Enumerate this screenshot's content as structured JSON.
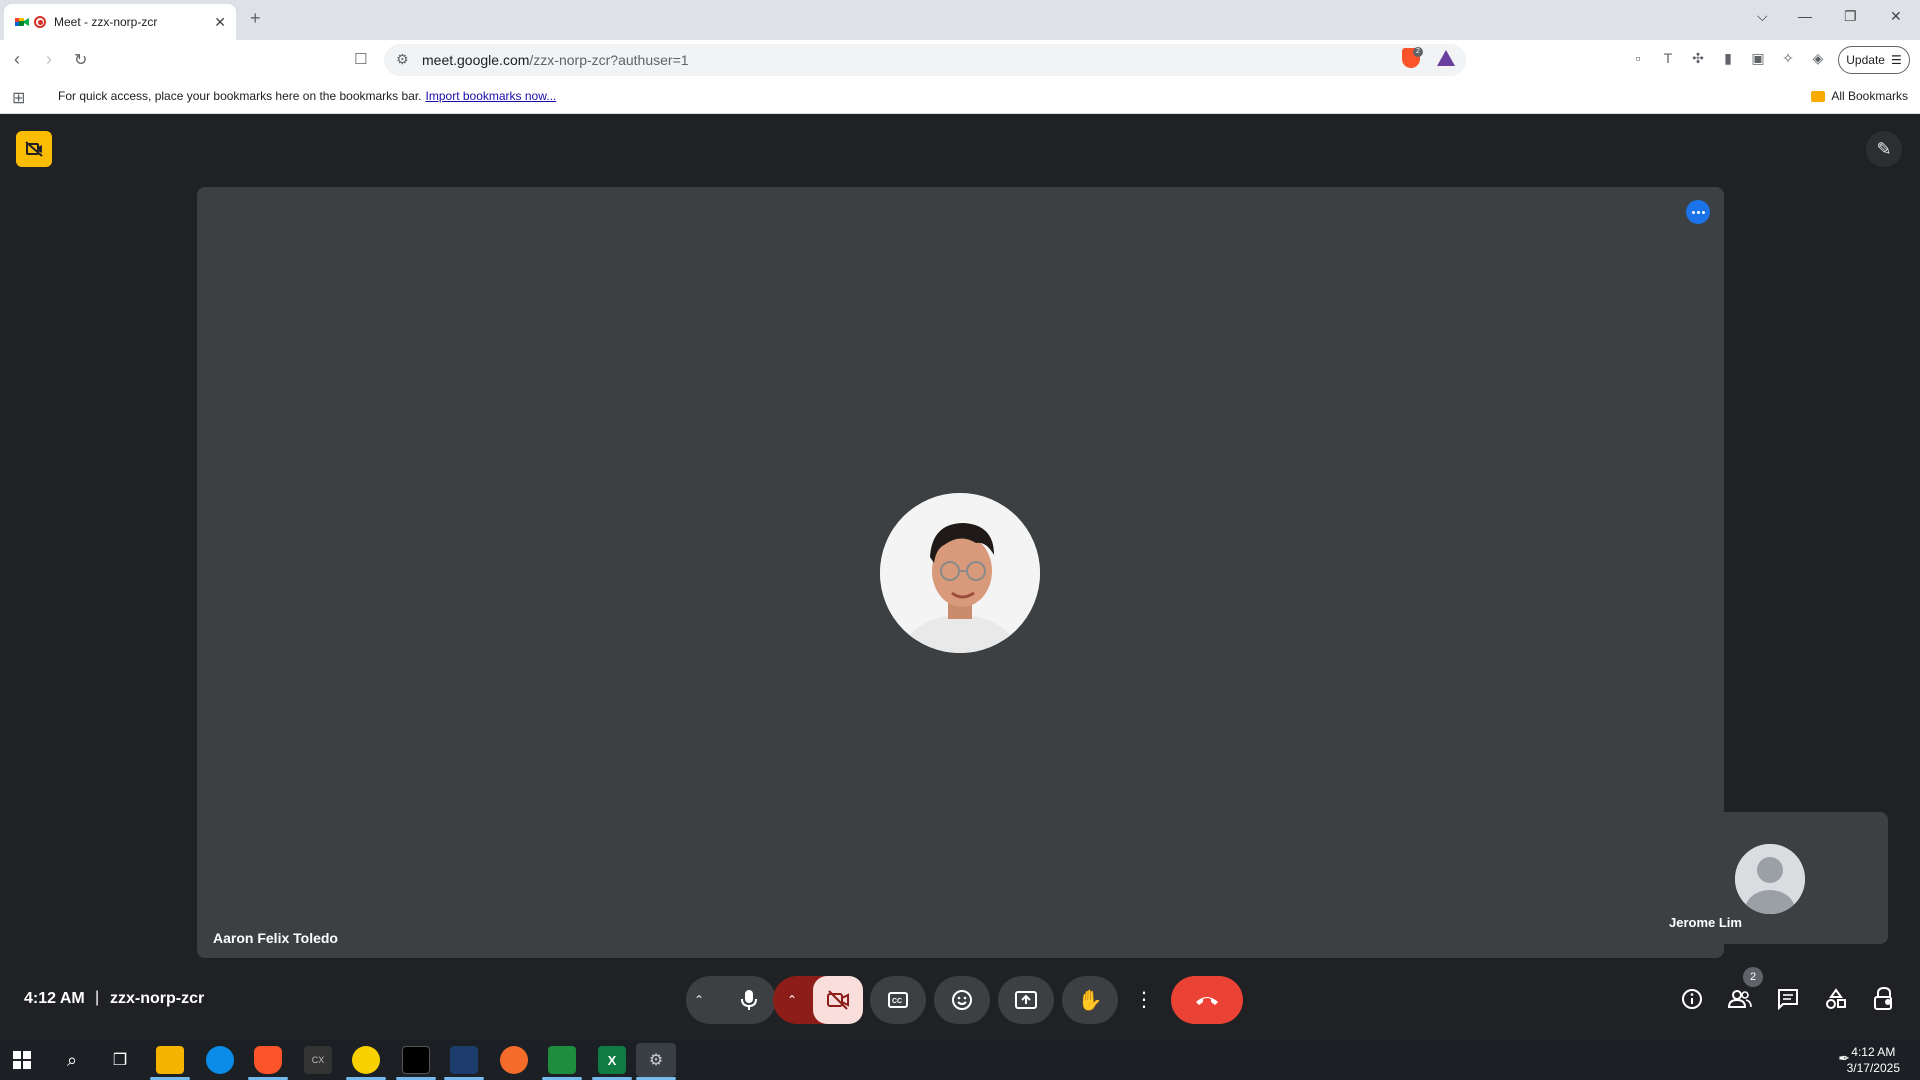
{
  "browser": {
    "tab_title": "Meet - zzx-norp-zcr",
    "url_host": "meet.google.com",
    "url_path": "/zzx-norp-zcr?authuser=1",
    "update_label": "Update",
    "brave_badge_count": "2",
    "bookmarks_hint": "For quick access, place your bookmarks here on the bookmarks bar.",
    "import_link": "Import bookmarks now...",
    "all_bookmarks": "All Bookmarks"
  },
  "meet": {
    "main_participant": "Aaron Felix Toledo",
    "self_participant": "Jerome Lim",
    "time": "4:12 AM",
    "separator": "|",
    "meeting_code": "zzx-norp-zcr",
    "people_count": "2"
  },
  "taskbar": {
    "time": "4:12 AM",
    "date": "3/17/2025"
  },
  "colors": {
    "meet_bg": "#202124",
    "tile_bg": "#3c4043",
    "end_call": "#ea4335",
    "cam_off_bg": "#f9dedc",
    "accent_blue": "#1a73e8",
    "no_cam_badge": "#fbbc04"
  }
}
